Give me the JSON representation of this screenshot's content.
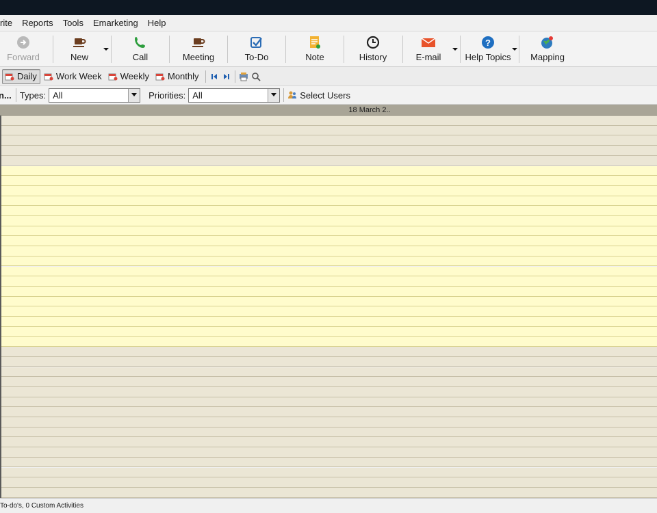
{
  "menu": [
    "rite",
    "Reports",
    "Tools",
    "Emarketing",
    "Help"
  ],
  "toolbar": {
    "forward": "Forward",
    "new": "New",
    "call": "Call",
    "meeting": "Meeting",
    "todo": "To-Do",
    "note": "Note",
    "history": "History",
    "email": "E-mail",
    "help_topics": "Help Topics",
    "mapping": "Mapping"
  },
  "views": {
    "daily": "Daily",
    "work_week": "Work Week",
    "weekly": "Weekly",
    "monthly": "Monthly",
    "active": "Daily"
  },
  "filters": {
    "clipped_label": "n...",
    "types_label": "Types:",
    "types_value": "All",
    "priorities_label": "Priorities:",
    "priorities_value": "All",
    "select_users": "Select Users"
  },
  "calendar": {
    "date_header": "18 March 2.."
  },
  "status": {
    "text": "To-do's, 0 Custom Activities"
  },
  "colors": {
    "off_hours": "#ebe6d5",
    "work_hours": "#fffccc",
    "header": "#a9a597",
    "titlebar": "#0d1722"
  }
}
